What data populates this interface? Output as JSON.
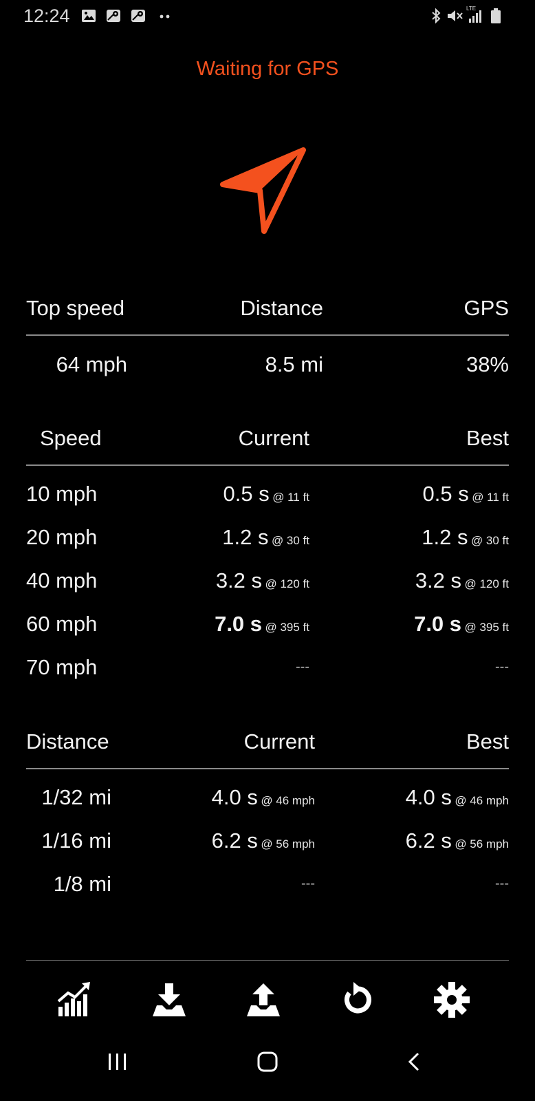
{
  "status_bar": {
    "time": "12:24",
    "left_icons": [
      "image-icon",
      "maps-icon",
      "maps-icon",
      "more-dots-icon"
    ],
    "right_icons": [
      "bluetooth-icon",
      "mute-icon",
      "lte-signal-icon",
      "battery-icon"
    ],
    "network_label": "LTE"
  },
  "gps_status": "Waiting for GPS",
  "accent_color": "#f4511e",
  "summary": {
    "headers": [
      "Top speed",
      "Distance",
      "GPS"
    ],
    "values": [
      "64 mph",
      "8.5 mi",
      "38%"
    ]
  },
  "speed_table": {
    "headers": [
      "Speed",
      "Current",
      "Best"
    ],
    "rows": [
      {
        "label": "10 mph",
        "current_time": "0.5 s",
        "current_at": "@ 11 ft",
        "best_time": "0.5 s",
        "best_at": "@ 11 ft"
      },
      {
        "label": "20 mph",
        "current_time": "1.2 s",
        "current_at": "@ 30 ft",
        "best_time": "1.2 s",
        "best_at": "@ 30 ft"
      },
      {
        "label": "40 mph",
        "current_time": "3.2 s",
        "current_at": "@ 120 ft",
        "best_time": "3.2 s",
        "best_at": "@ 120 ft"
      },
      {
        "label": "60 mph",
        "current_time": "7.0 s",
        "current_at": "@ 395 ft",
        "best_time": "7.0 s",
        "best_at": "@ 395 ft"
      },
      {
        "label": "70 mph",
        "current_empty": "---",
        "best_empty": "---"
      }
    ]
  },
  "distance_table": {
    "headers": [
      "Distance",
      "Current",
      "Best"
    ],
    "rows": [
      {
        "label": "1/32 mi",
        "current_time": "4.0 s",
        "current_at": "@ 46 mph",
        "best_time": "4.0 s",
        "best_at": "@ 46 mph"
      },
      {
        "label": "1/16 mi",
        "current_time": "6.2 s",
        "current_at": "@ 56 mph",
        "best_time": "6.2 s",
        "best_at": "@ 56 mph"
      },
      {
        "label": "1/8 mi",
        "current_empty": "---",
        "best_empty": "---"
      }
    ]
  },
  "toolbar": [
    "chart-icon",
    "download-icon",
    "upload-icon",
    "reset-icon",
    "settings-icon"
  ],
  "nav_bar": [
    "recents-icon",
    "home-icon",
    "back-icon"
  ]
}
